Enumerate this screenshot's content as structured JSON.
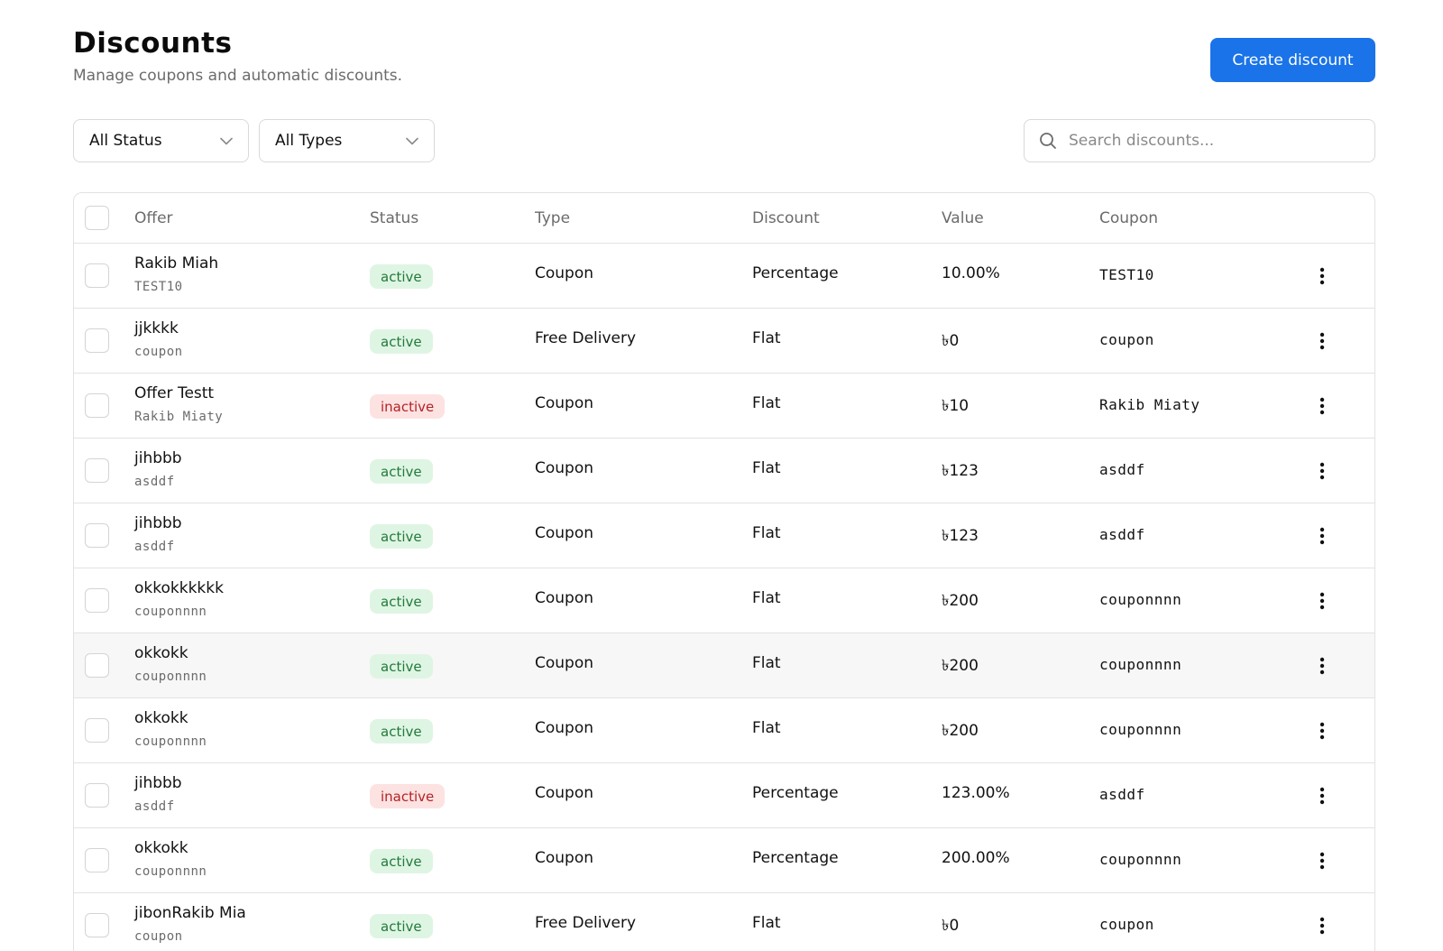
{
  "header": {
    "title": "Discounts",
    "subtitle": "Manage coupons and automatic discounts.",
    "create_label": "Create discount"
  },
  "filters": {
    "status": "All Status",
    "type": "All Types"
  },
  "search": {
    "placeholder": "Search discounts..."
  },
  "table": {
    "columns": [
      "Offer",
      "Status",
      "Type",
      "Discount",
      "Value",
      "Coupon"
    ],
    "rows": [
      {
        "offer": "Rakib Miah",
        "code": "TEST10",
        "status": "active",
        "type": "Coupon",
        "discount": "Percentage",
        "value": "10.00%",
        "coupon": "TEST10"
      },
      {
        "offer": "jjkkkk",
        "code": "coupon",
        "status": "active",
        "type": "Free Delivery",
        "discount": "Flat",
        "value": "৳0",
        "coupon": "coupon"
      },
      {
        "offer": "Offer Testt",
        "code": "Rakib Miaty",
        "status": "inactive",
        "type": "Coupon",
        "discount": "Flat",
        "value": "৳10",
        "coupon": "Rakib Miaty"
      },
      {
        "offer": "jihbbb",
        "code": "asddf",
        "status": "active",
        "type": "Coupon",
        "discount": "Flat",
        "value": "৳123",
        "coupon": "asddf"
      },
      {
        "offer": "jihbbb",
        "code": "asddf",
        "status": "active",
        "type": "Coupon",
        "discount": "Flat",
        "value": "৳123",
        "coupon": "asddf"
      },
      {
        "offer": "okkokkkkkk",
        "code": "couponnnn",
        "status": "active",
        "type": "Coupon",
        "discount": "Flat",
        "value": "৳200",
        "coupon": "couponnnn"
      },
      {
        "offer": "okkokk",
        "code": "couponnnn",
        "status": "active",
        "type": "Coupon",
        "discount": "Flat",
        "value": "৳200",
        "coupon": "couponnnn"
      },
      {
        "offer": "okkokk",
        "code": "couponnnn",
        "status": "active",
        "type": "Coupon",
        "discount": "Flat",
        "value": "৳200",
        "coupon": "couponnnn"
      },
      {
        "offer": "jihbbb",
        "code": "asddf",
        "status": "inactive",
        "type": "Coupon",
        "discount": "Percentage",
        "value": "123.00%",
        "coupon": "asddf"
      },
      {
        "offer": "okkokk",
        "code": "couponnnn",
        "status": "active",
        "type": "Coupon",
        "discount": "Percentage",
        "value": "200.00%",
        "coupon": "couponnnn"
      },
      {
        "offer": "jibonRakib Mia",
        "code": "coupon",
        "status": "active",
        "type": "Free Delivery",
        "discount": "Flat",
        "value": "৳0",
        "coupon": "coupon"
      }
    ]
  },
  "colors": {
    "primary": "#1a73e8",
    "active_bg": "#dff5e4",
    "active_text": "#237a3a",
    "inactive_bg": "#fde2e2",
    "inactive_text": "#b42323"
  },
  "icons": {
    "select_chevron": "chevron-down-icon",
    "search": "search-icon",
    "row_actions": "more-vertical-icon"
  }
}
